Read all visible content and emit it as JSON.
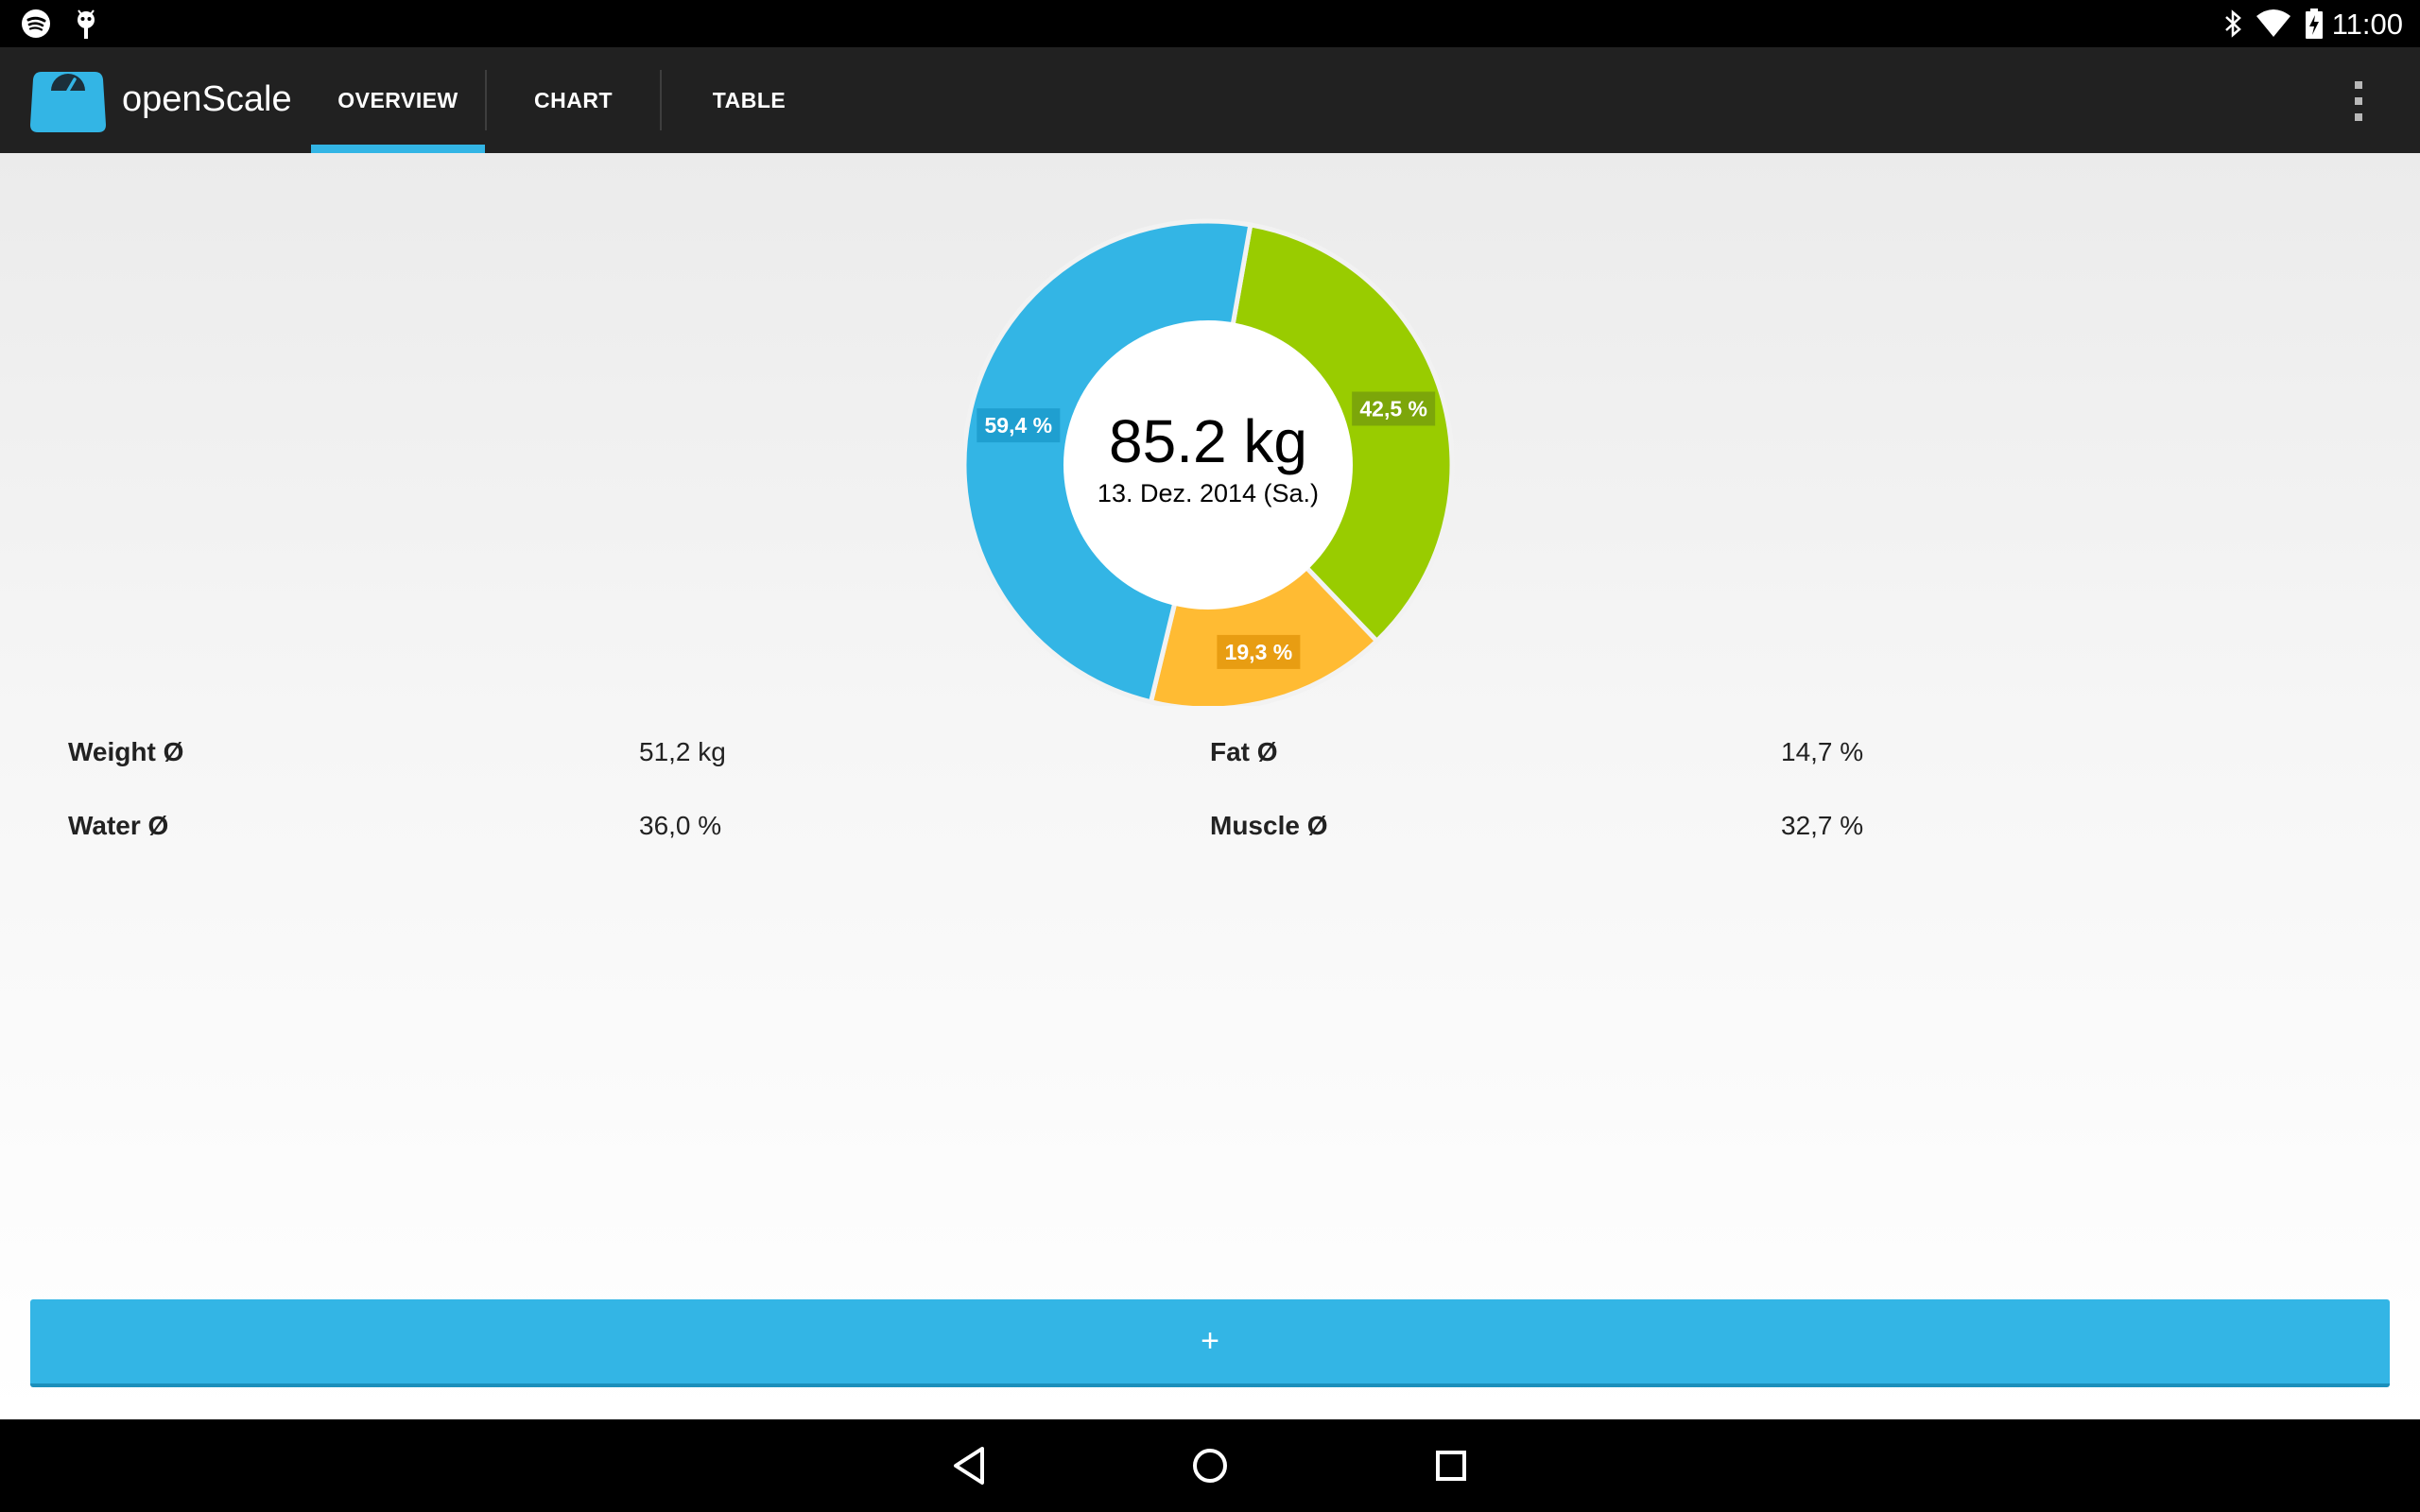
{
  "status_bar": {
    "time": "11:00",
    "left_icons": [
      "spotify-icon",
      "android-debug-icon"
    ],
    "right_icons": [
      "bluetooth-icon",
      "wifi-icon",
      "battery-charging-icon"
    ]
  },
  "action_bar": {
    "app_title": "openScale",
    "tabs": [
      {
        "label": "OVERVIEW",
        "selected": true
      },
      {
        "label": "CHART",
        "selected": false
      },
      {
        "label": "TABLE",
        "selected": false
      }
    ],
    "overflow_icon": "more-vert-icon"
  },
  "overview": {
    "center_weight": "85.2 kg",
    "center_date": "13. Dez. 2014 (Sa.)",
    "stats": [
      {
        "label": "Weight Ø",
        "value": "51,2 kg"
      },
      {
        "label": "Fat Ø",
        "value": "14,7 %"
      },
      {
        "label": "Water Ø",
        "value": "36,0 %"
      },
      {
        "label": "Muscle Ø",
        "value": "32,7 %"
      }
    ],
    "add_button_label": "+"
  },
  "chart_data": {
    "type": "pie",
    "style": "donut",
    "slices": [
      {
        "label": "42,5 %",
        "value": 42.5,
        "color": "#99cc00"
      },
      {
        "label": "19,3 %",
        "value": 19.3,
        "color": "#ffbb33"
      },
      {
        "label": "59,4 %",
        "value": 59.4,
        "color": "#33b5e5"
      }
    ]
  },
  "colors": {
    "accent": "#33b5e5",
    "action_bar": "#212121",
    "green": "#99cc00",
    "orange": "#ffbb33"
  },
  "nav_bar": {
    "icons": [
      "back-icon",
      "home-icon",
      "recents-icon"
    ]
  }
}
